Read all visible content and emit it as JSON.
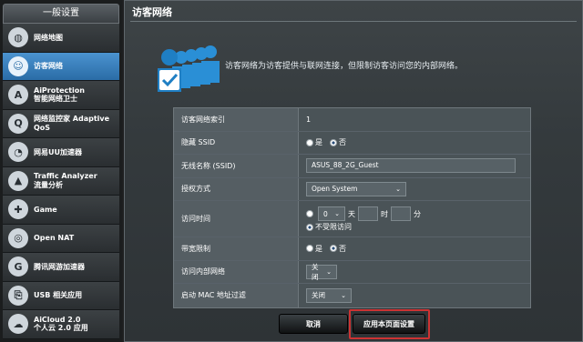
{
  "sidebar": {
    "header": "一般设置",
    "items": [
      {
        "label": "网络地图",
        "icon": "globe-network-icon",
        "glyph": "◍",
        "active": false
      },
      {
        "label": "访客网络",
        "icon": "guest-network-icon",
        "glyph": "☺",
        "active": true
      },
      {
        "label": "AiProtection\n智能网络卫士",
        "icon": "aiprotection-shield-icon",
        "glyph": "A",
        "active": false
      },
      {
        "label": "网络监控家 Adaptive\nQoS",
        "icon": "qos-gauge-icon",
        "glyph": "Q",
        "active": false
      },
      {
        "label": "网易UU加速器",
        "icon": "uu-accelerator-icon",
        "glyph": "◔",
        "active": false
      },
      {
        "label": "Traffic Analyzer\n流量分析",
        "icon": "traffic-analyzer-icon",
        "glyph": "▲",
        "active": false
      },
      {
        "label": "Game",
        "icon": "game-controller-icon",
        "glyph": "✚",
        "active": false
      },
      {
        "label": "Open NAT",
        "icon": "open-nat-icon",
        "glyph": "◎",
        "active": false
      },
      {
        "label": "腾讯网游加速器",
        "icon": "tencent-game-accelerator-icon",
        "glyph": "G",
        "active": false
      },
      {
        "label": "USB 相关应用",
        "icon": "usb-icon",
        "glyph": "⎘",
        "active": false
      },
      {
        "label": "AiCloud 2.0\n个人云 2.0 应用",
        "icon": "aicloud-icon",
        "glyph": "☁",
        "active": false
      }
    ]
  },
  "main": {
    "title": "访客网络",
    "description": "访客网络为访客提供与联网连接，但限制访客访问您的内部网络。"
  },
  "form": {
    "index": {
      "label": "访客网络索引",
      "value": "1"
    },
    "hide_ssid": {
      "label": "隐藏 SSID",
      "yes": "是",
      "no": "否",
      "selected": "no"
    },
    "ssid": {
      "label": "无线名称 (SSID)",
      "value": "ASUS_88_2G_Guest"
    },
    "auth": {
      "label": "授权方式",
      "value": "Open System"
    },
    "access_time": {
      "label": "访问时间",
      "days_value": "0",
      "days_unit": "天",
      "hours_unit": "时",
      "minutes_unit": "分",
      "unlimited": "不受限访问"
    },
    "bandwidth": {
      "label": "带宽限制",
      "yes": "是",
      "no": "否",
      "selected": "no"
    },
    "intranet": {
      "label": "访问内部网络",
      "value": "关闭"
    },
    "mac_filter": {
      "label": "启动 MAC 地址过滤",
      "value": "关闭"
    }
  },
  "buttons": {
    "cancel": "取消",
    "apply": "应用本页面设置"
  },
  "colors": {
    "active_tab": "#3b82c4",
    "highlight": "#cc3333",
    "panel": "#3a4043"
  }
}
